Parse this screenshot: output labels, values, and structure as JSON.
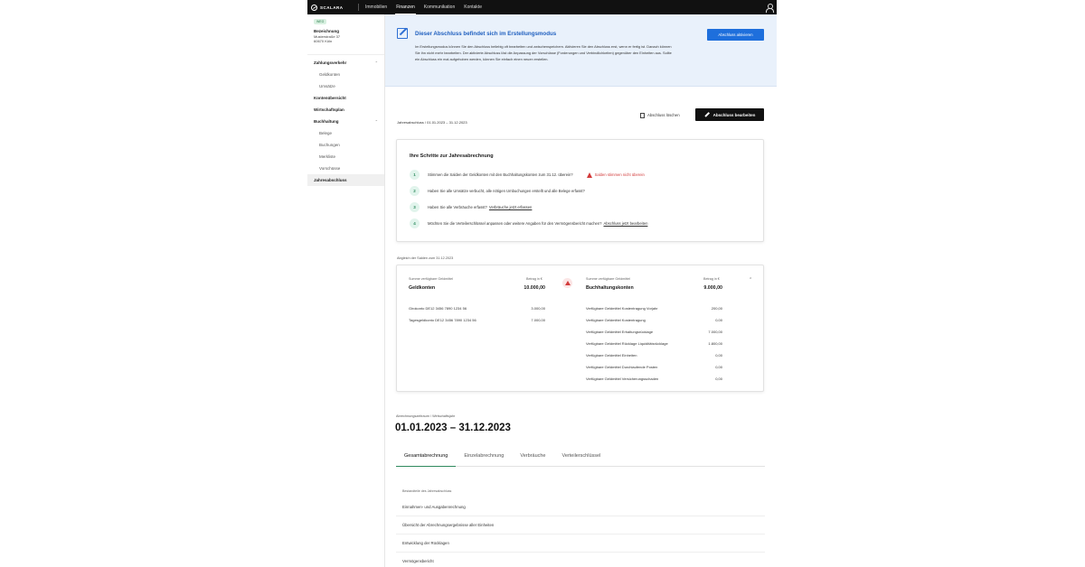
{
  "topbar": {
    "logo_text": "SCALARA",
    "nav": [
      "Immobilien",
      "Finanzen",
      "Kommunikation",
      "Kontakte"
    ],
    "active_nav": "Finanzen"
  },
  "sidebar": {
    "badge": "WEG",
    "property_name": "Bezeichnung",
    "address_line1": "Musterstraße 37",
    "address_line2": "60670 Köln",
    "groups": [
      {
        "label": "Zahlungsverkehr",
        "items": [
          "Geldkonten",
          "Umsätze"
        ]
      },
      {
        "label": "Buchhaltung",
        "items": [
          "Belege",
          "Buchungen",
          "Merkliste",
          "Vorschüsse"
        ]
      }
    ],
    "links": [
      "Kontenübersicht",
      "Wirtschaftsplan",
      "Jahresabschluss"
    ],
    "active": "Jahresabschluss"
  },
  "banner": {
    "title": "Dieser Abschluss befindet sich im Erstellungsmodus",
    "text": "Im Erstellungsmodus können Sie den Abschluss beliebig oft bearbeiten und zwischenspeichern. Aktivieren Sie den Abschluss erst, wenn er fertig ist. Danach können Sie ihn nicht mehr bearbeiten. Der aktivierte Abschluss löst die Anpassung der Vorschüsse (Forderungen und Verbindlichkeiten) gegenüber den Einheiten aus. Sollte ein Abschluss ein mal aufgehoben werden, können Sie einfach einen neuen erstellen.",
    "button": "Abschluss aktivieren"
  },
  "toolbar": {
    "breadcrumb": "Jahresabschluss  /  01.01.2023 – 31.12.2023",
    "delete_label": "Abschluss löschen",
    "edit_label": "Abschluss bearbeiten"
  },
  "steps": {
    "title": "Ihre Schritte zur Jahresabrechnung",
    "items": [
      {
        "num": "1",
        "text": "Stimmen die Salden der Geldkonten mit den Buchhaltungskonten zum 31.12. überein?",
        "warning": "Salden stimmen nicht überein"
      },
      {
        "num": "2",
        "text": "Haben Sie alle Umsätze verbucht, alle nötigen Umbuchungen erstellt und alle Belege erfasst?"
      },
      {
        "num": "3",
        "text": "Haben Sie alle Verbräuche erfasst?",
        "link": "Verbräuche jetzt erfassen"
      },
      {
        "num": "4",
        "text": "Möchten Sie die Verteilerschlüssel anpassen oder weitere Angaben für den Vermögensbericht machen?",
        "link": "Abschluss jetzt bearbeiten"
      }
    ]
  },
  "balance": {
    "label": "Abgleich der Salden zum 31.12.2023",
    "left": {
      "sum_label": "Summe verfügbare Geldmittel",
      "title": "Geldkonten",
      "amount_label": "Betrag in €",
      "amount": "10.000,00",
      "rows": [
        {
          "name": "Girokonto DE12 3456 7890 1234 56",
          "value": "3.000,00"
        },
        {
          "name": "Tagesgeldkonto DE12 3456 7890 1234 56",
          "value": "7.000,00"
        }
      ]
    },
    "right": {
      "sum_label": "Summe verfügbare Geldmittel",
      "title": "Buchhaltungskonten",
      "amount_label": "Betrag in €",
      "amount": "9.000,00",
      "rows": [
        {
          "name": "Verfügbare Geldmittel Kostentragung Vorjahr",
          "value": "200,00"
        },
        {
          "name": "Verfügbare Geldmittel Kostentragung",
          "value": "0,00"
        },
        {
          "name": "Verfügbare Geldmittel Erhaltungsrücklage",
          "value": "7.000,00"
        },
        {
          "name": "Verfügbare Geldmittel Rücklage Liquiditätsrücklage",
          "value": "1.800,00"
        },
        {
          "name": "Verfügbare Geldmittel Einheiten",
          "value": "0,00"
        },
        {
          "name": "Verfügbare Geldmittel Durchlaufende Posten",
          "value": "0,00"
        },
        {
          "name": "Verfügbare Geldmittel Versicherungsschaden",
          "value": "0,00"
        }
      ]
    }
  },
  "period": {
    "sub": "Abrechnungszeitraum / Wirtschaftsjahr",
    "title": "01.01.2023 – 31.12.2023"
  },
  "tabs": [
    "Gesamtabrechnung",
    "Einzelabrechnung",
    "Verbräuche",
    "Verteilerschlüssel"
  ],
  "components": {
    "label": "Bestandteile des Jahresabschluss",
    "items": [
      "Einnahmen- und Ausgabenrechnung",
      "Übersicht der Abrechnungsergebnisse aller Einheiten",
      "Entwicklung der Rücklagen",
      "Vermögensbericht"
    ]
  },
  "colors": {
    "accent_blue": "#1e6fdc",
    "accent_green": "#2f8a5e",
    "warning_red": "#d23a3a"
  }
}
